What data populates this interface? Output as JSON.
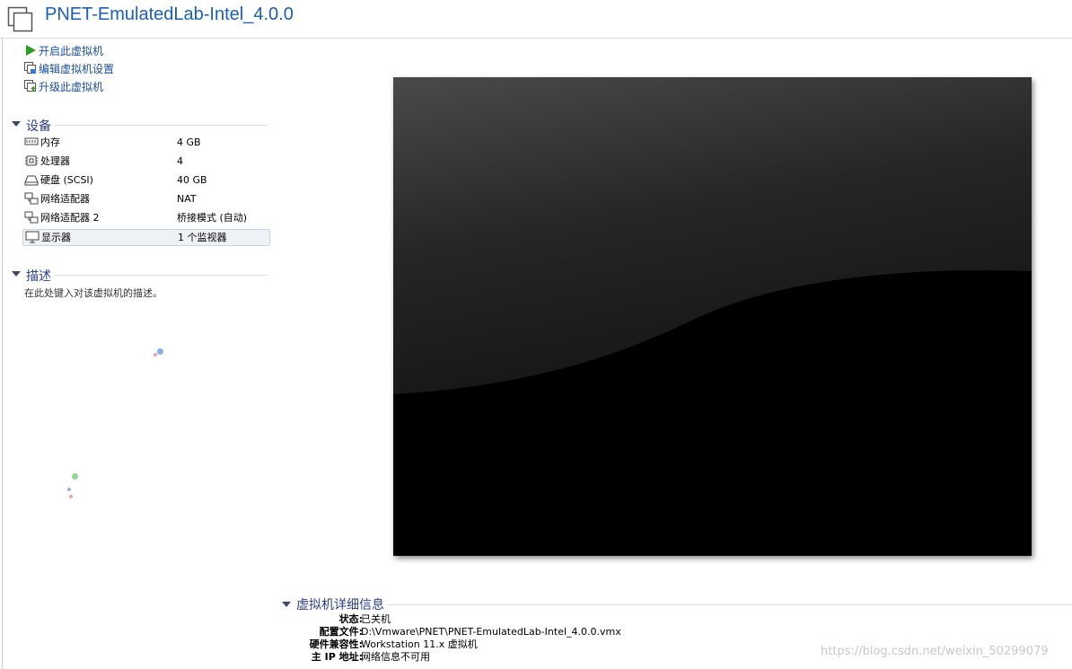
{
  "header": {
    "title": "PNET-EmulatedLab-Intel_4.0.0"
  },
  "actions": [
    {
      "label": "开启此虚拟机",
      "icon": "play-icon"
    },
    {
      "label": "编辑虚拟机设置",
      "icon": "edit-settings-icon"
    },
    {
      "label": "升级此虚拟机",
      "icon": "upgrade-icon"
    }
  ],
  "devices": {
    "title": "设备",
    "items": [
      {
        "name": "内存",
        "value": "4 GB",
        "icon": "memory-icon"
      },
      {
        "name": "处理器",
        "value": "4",
        "icon": "cpu-icon"
      },
      {
        "name": "硬盘 (SCSI)",
        "value": "40 GB",
        "icon": "hard-disk-icon"
      },
      {
        "name": "网络适配器",
        "value": "NAT",
        "icon": "network-adapter-icon"
      },
      {
        "name": "网络适配器 2",
        "value": "桥接模式 (自动)",
        "icon": "network-adapter-icon"
      },
      {
        "name": "显示器",
        "value": "1 个监视器",
        "icon": "display-icon"
      }
    ]
  },
  "description": {
    "title": "描述",
    "placeholder": "在此处键入对该虚拟机的描述。"
  },
  "details": {
    "title": "虚拟机详细信息",
    "rows": [
      {
        "key": "状态:",
        "value": "已关机"
      },
      {
        "key": "配置文件:",
        "value": "D:\\Vmware\\PNET\\PNET-EmulatedLab-Intel_4.0.0.vmx"
      },
      {
        "key": "硬件兼容性:",
        "value": "Workstation 11.x 虚拟机"
      },
      {
        "key": "主 IP 地址:",
        "value": "网络信息不可用"
      }
    ]
  },
  "watermark": "https://blog.csdn.net/weixin_50299079",
  "colors": {
    "title_blue": "#1a5fb4",
    "link_blue": "#1a4f9c",
    "section_blue": "#2a3f8f",
    "play_green": "#2e9e1f"
  }
}
